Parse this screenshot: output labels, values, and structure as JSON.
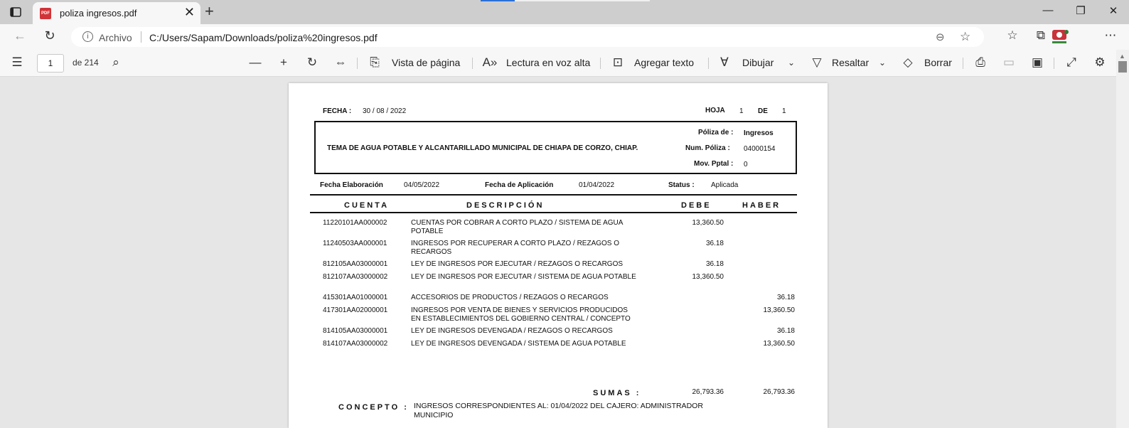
{
  "browser": {
    "tab_title": "poliza ingresos.pdf",
    "pdf_badge": "PDF",
    "site_label": "Archivo",
    "url": "C:/Users/Sapam/Downloads/poliza%20ingresos.pdf"
  },
  "toolbar": {
    "page_number": "1",
    "page_of": "de 214",
    "page_view": "Vista de página",
    "read_aloud": "Lectura en voz alta",
    "add_text": "Agregar texto",
    "draw": "Dibujar",
    "highlight": "Resaltar",
    "erase": "Borrar"
  },
  "doc": {
    "fecha_label": "FECHA :",
    "fecha": "30 / 08 / 2022",
    "hoja_label": "HOJA",
    "hoja": "1",
    "de_label": "DE",
    "de": "1",
    "entity": "TEMA DE AGUA POTABLE Y ALCANTARILLADO MUNICIPAL DE CHIAPA DE CORZO, CHIAP.",
    "poliza_de_label": "Póliza de :",
    "poliza_de": "Ingresos",
    "num_poliza_label": "Num. Póliza :",
    "num_poliza": "04000154",
    "mov_pptal_label": "Mov. Pptal :",
    "mov_pptal": "0",
    "fecha_elab_label": "Fecha Elaboración",
    "fecha_elab": "04/05/2022",
    "fecha_apl_label": "Fecha de Aplicación",
    "fecha_apl": "01/04/2022",
    "status_label": "Status :",
    "status": "Aplicada",
    "col_cuenta": "CUENTA",
    "col_descripcion": "DESCRIPCIÓN",
    "col_debe": "DEBE",
    "col_haber": "HABER",
    "rows": [
      {
        "cuenta": "11220101AA000002",
        "descripcion": "CUENTAS POR COBRAR A CORTO PLAZO / SISTEMA DE AGUA POTABLE",
        "debe": "13,360.50",
        "haber": ""
      },
      {
        "cuenta": "11240503AA000001",
        "descripcion": "INGRESOS POR RECUPERAR A CORTO PLAZO / REZAGOS O RECARGOS",
        "debe": "36.18",
        "haber": ""
      },
      {
        "cuenta": "812105AA03000001",
        "descripcion": "LEY DE INGRESOS POR EJECUTAR / REZAGOS O RECARGOS",
        "debe": "36.18",
        "haber": ""
      },
      {
        "cuenta": "812107AA03000002",
        "descripcion": "LEY DE INGRESOS POR EJECUTAR / SISTEMA DE AGUA POTABLE",
        "debe": "13,360.50",
        "haber": ""
      },
      {
        "cuenta": "415301AA01000001",
        "descripcion": "ACCESORIOS DE PRODUCTOS / REZAGOS O RECARGOS",
        "debe": "",
        "haber": "36.18"
      },
      {
        "cuenta": "417301AA02000001",
        "descripcion": "INGRESOS POR VENTA DE BIENES Y SERVICIOS PRODUCIDOS EN ESTABLECIMIENTOS DEL GOBIERNO CENTRAL / CONCEPTO",
        "debe": "",
        "haber": "13,360.50"
      },
      {
        "cuenta": "814105AA03000001",
        "descripcion": "LEY DE INGRESOS DEVENGADA / REZAGOS O RECARGOS",
        "debe": "",
        "haber": "36.18"
      },
      {
        "cuenta": "814107AA03000002",
        "descripcion": "LEY DE INGRESOS DEVENGADA / SISTEMA DE AGUA POTABLE",
        "debe": "",
        "haber": "13,360.50"
      }
    ],
    "sumas_label": "SUMAS :",
    "sumas_debe": "26,793.36",
    "sumas_haber": "26,793.36",
    "concepto_label": "CONCEPTO :",
    "concepto": "INGRESOS CORRESPONDIENTES AL: 01/04/2022 DEL CAJERO: ADMINISTRADOR MUNICIPIO"
  }
}
